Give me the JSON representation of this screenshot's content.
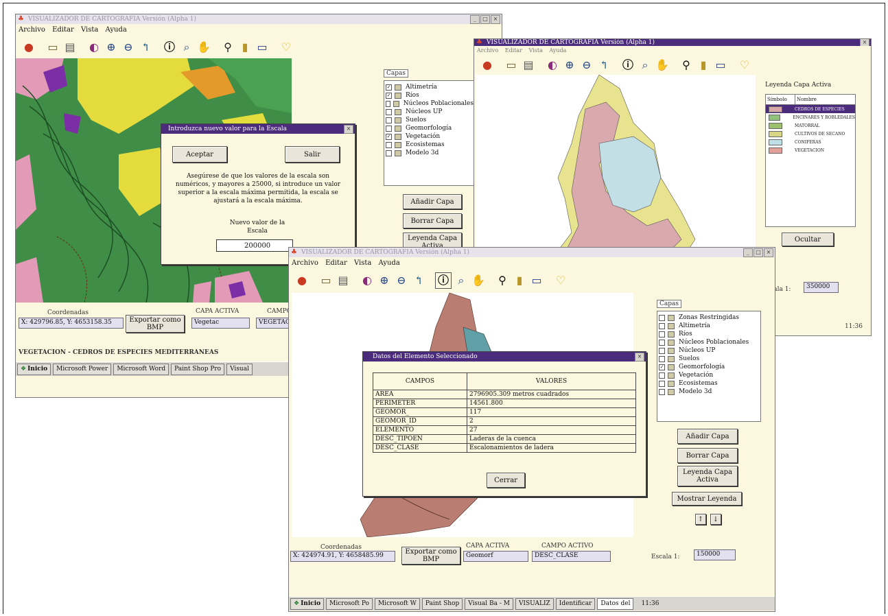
{
  "app": {
    "icon": "app-logo-icon",
    "title_back": "VISUALIZADOR DE CARTOGRAFIA Versión (Alpha 1)",
    "title_front": "VISUALIZADOR DE CARTOGRAFIA Versión (Alpha 1)",
    "title_right": "VISUALIZADOR DE CARTOGRAFIA Versión (Alpha 1)",
    "win_min": "_",
    "win_max": "□",
    "win_close": "×"
  },
  "menu": [
    "Archivo",
    "Editar",
    "Vista",
    "Ayuda"
  ],
  "toolbar": [
    "layer-globe-icon",
    "folder-open-icon",
    "print-icon",
    "globe-icon",
    "zoom-in-icon",
    "zoom-out-icon",
    "pan-icon",
    "info-icon",
    "zoom-box-icon",
    "hand-icon",
    "find-binoculars-icon",
    "bar-chart-icon",
    "frame-icon",
    "tip-bulb-icon"
  ],
  "back_window": {
    "coords_label": "Coordenadas",
    "coords_value": "X: 429796.85, Y: 4653158.35",
    "export_btn": "Exportar como BMP",
    "active_layer_label": "CAPA ACTIVA",
    "active_layer_value": "Vegetac",
    "active_field_label": "CAMPO",
    "active_field_value": "VEGETAC",
    "status_text": "VEGETACION - CEDROS DE ESPECIES MEDITERRANEAS",
    "layers_tab": "Capas",
    "layers": [
      {
        "name": "Altimetría",
        "checked": true
      },
      {
        "name": "Ríos",
        "checked": true
      },
      {
        "name": "Núcleos Poblacionales",
        "checked": false
      },
      {
        "name": "Núcleos UP",
        "checked": false
      },
      {
        "name": "Suelos",
        "checked": false
      },
      {
        "name": "Geomorfología",
        "checked": false
      },
      {
        "name": "Vegetación",
        "checked": true
      },
      {
        "name": "Ecosistemas",
        "checked": false
      },
      {
        "name": "Modelo 3d",
        "checked": false
      }
    ],
    "add_layer": "Añadir Capa",
    "delete_layer": "Borrar Capa",
    "legend_active": "Leyenda Capa Activa"
  },
  "scale_dialog": {
    "title": "Introduzca nuevo valor para la Escala",
    "accept": "Aceptar",
    "exit": "Salir",
    "message": "Asegúrese de que los valores de la escala son numéricos, y mayores a 25000, si introduce un valor superior a la escala máxima permitida, la escala se ajustará a la escala máxima.",
    "new_value_label": "Nuevo valor de la Escala",
    "value": "200000"
  },
  "right_window": {
    "legend_title": "Leyenda Capa Activa",
    "legend_col_symbol": "Símbolo",
    "legend_col_name": "Nombre",
    "legend_items": [
      {
        "color": "#d6a6a8",
        "name": "CEDROS DE ESPECIES"
      },
      {
        "color": "#8fc37a",
        "name": "ENCINARES Y ROBLEDALES"
      },
      {
        "color": "#9bbf6a",
        "name": "MATORRAL"
      },
      {
        "color": "#d8d586",
        "name": "CULTIVOS DE SECANO"
      },
      {
        "color": "#bfe0e6",
        "name": "CONIFERAS"
      },
      {
        "color": "#e3a098",
        "name": "VEGETACION"
      }
    ],
    "ocultar": "Ocultar",
    "scale_label": "Escala 1:",
    "scale_value": "350000",
    "clock": "11:36"
  },
  "front_window": {
    "coords_label": "Coordenadas",
    "coords_value": "X: 424974.91, Y: 4658485.99",
    "export_btn": "Exportar como BMP",
    "active_layer_label": "CAPA ACTIVA",
    "active_layer_value": "Geomorf",
    "active_field_label": "CAMPO ACTIVO",
    "active_field_value": "DESC_CLASE",
    "scale_label": "Escala 1:",
    "scale_value": "150000",
    "layers_tab": "Capas",
    "layers": [
      {
        "name": "Zonas Restringidas",
        "checked": false
      },
      {
        "name": "Altimetría",
        "checked": false
      },
      {
        "name": "Ríos",
        "checked": false
      },
      {
        "name": "Núcleos Poblacionales",
        "checked": false
      },
      {
        "name": "Núcleos UP",
        "checked": false
      },
      {
        "name": "Suelos",
        "checked": false
      },
      {
        "name": "Geomorfología",
        "checked": true
      },
      {
        "name": "Vegetación",
        "checked": false
      },
      {
        "name": "Ecosistemas",
        "checked": false
      },
      {
        "name": "Modelo 3d",
        "checked": false
      }
    ],
    "add_layer": "Añadir Capa",
    "delete_layer": "Borrar Capa",
    "legend_active": "Leyenda Capa Activa",
    "show_legend": "Mostrar Leyenda",
    "up": "↑",
    "down": "↓"
  },
  "data_dialog": {
    "title": "Datos del Elemento Seleccionado",
    "col_field": "CAMPOS",
    "col_value": "VALORES",
    "rows": [
      {
        "field": "AREA",
        "value": "2796905.309 metros cuadrados"
      },
      {
        "field": "PERIMETER",
        "value": "14561.800"
      },
      {
        "field": "GEOMOR_",
        "value": "117"
      },
      {
        "field": "GEOMOR_ID",
        "value": "2"
      },
      {
        "field": "ELEMENTO",
        "value": "27"
      },
      {
        "field": "DESC_TIPOEN",
        "value": "Laderas de la cuenca"
      },
      {
        "field": "DESC_CLASE",
        "value": "Escalonamientos de ladera"
      }
    ],
    "close": "Cerrar"
  },
  "taskbar_back": [
    {
      "icon": "start-icon",
      "label": "Inicio"
    },
    {
      "icon": "doc-icon",
      "label": "Microsoft Power"
    },
    {
      "icon": "doc-icon",
      "label": "Microsoft Word"
    },
    {
      "icon": "doc-icon",
      "label": "Paint Shop Pro"
    },
    {
      "icon": "doc-icon",
      "label": "Visual"
    }
  ],
  "taskbar_front": [
    {
      "icon": "start-icon",
      "label": "Inicio"
    },
    {
      "icon": "doc-icon",
      "label": "Microsoft Po"
    },
    {
      "icon": "doc-icon",
      "label": "Microsoft W"
    },
    {
      "icon": "doc-icon",
      "label": "Paint Shop"
    },
    {
      "icon": "doc-icon",
      "label": "Visual Ba - M"
    },
    {
      "icon": "doc-icon",
      "label": "VISUALIZ"
    },
    {
      "icon": "doc-icon",
      "label": "Identificar"
    },
    {
      "icon": "doc-icon",
      "label": "Datos del"
    }
  ],
  "clock_front": "11:36",
  "colors": {
    "title_dark": "#4a2b7c",
    "window_bg": "#fbf8df",
    "map_green": "#3f8d46",
    "map_yellow": "#e4dc3d",
    "map_pink": "#e39ab6",
    "map_purple": "#7b2ea5",
    "map_orange": "#e49a2a"
  }
}
